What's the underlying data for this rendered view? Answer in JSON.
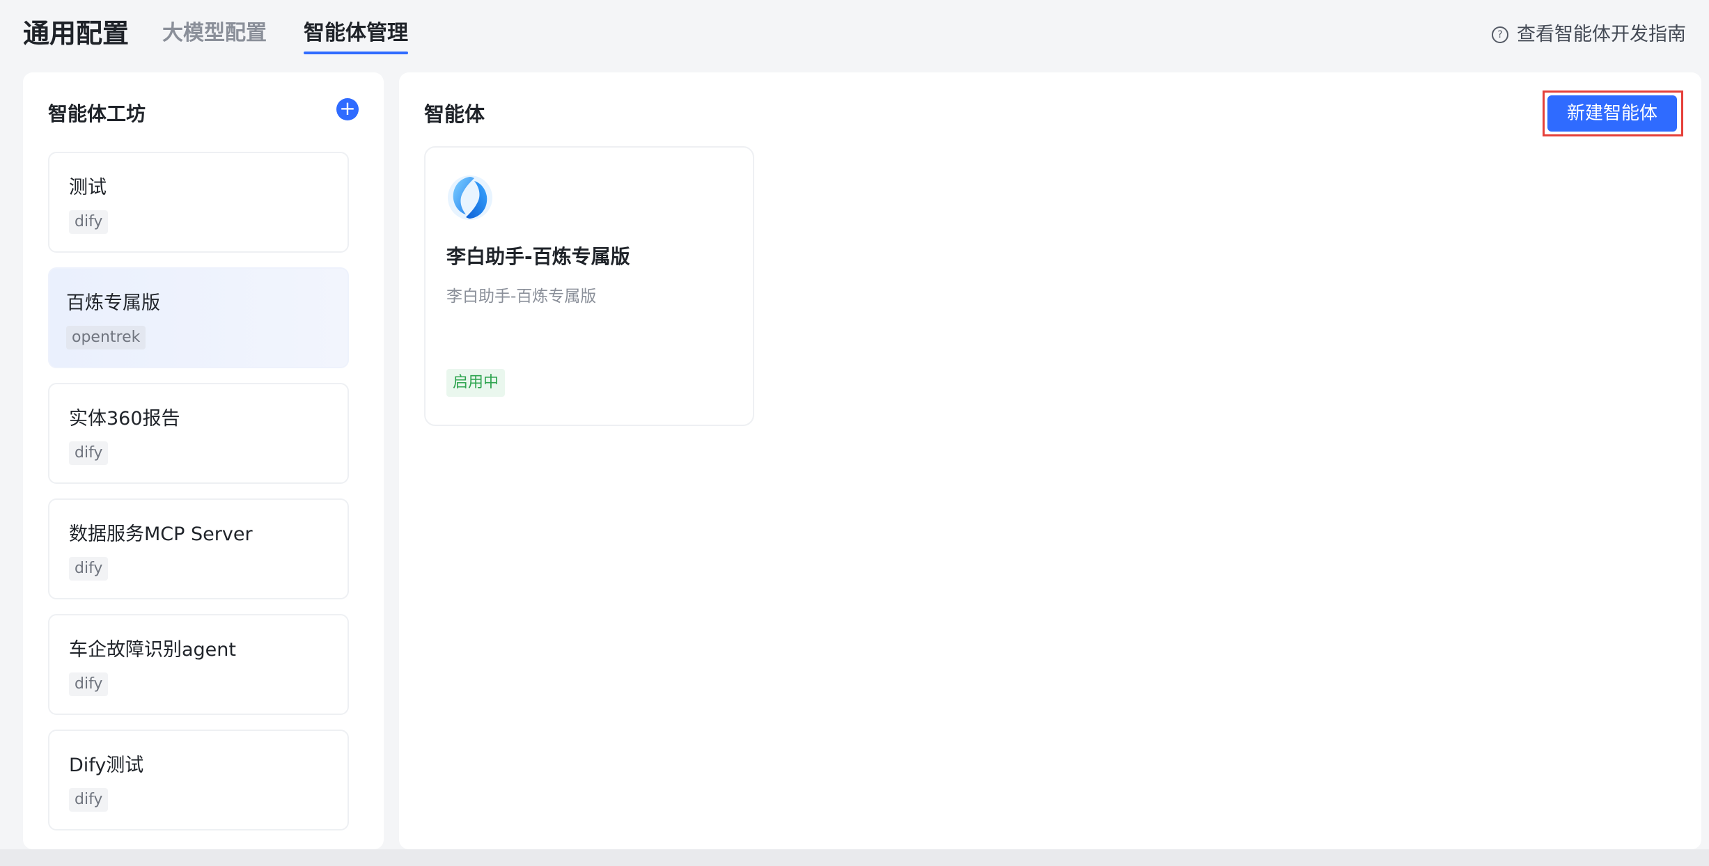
{
  "header": {
    "title": "通用配置",
    "tabs": [
      {
        "label": "大模型配置",
        "active": false
      },
      {
        "label": "智能体管理",
        "active": true
      }
    ],
    "guide_link": "查看智能体开发指南",
    "guide_icon": "help-circle-icon",
    "accent_color": "#2f6bff"
  },
  "sidebar": {
    "title": "智能体工坊",
    "add_icon": "plus-icon",
    "items": [
      {
        "name": "测试",
        "tag": "dify",
        "selected": false
      },
      {
        "name": "百炼专属版",
        "tag": "opentrek",
        "selected": true
      },
      {
        "name": "实体360报告",
        "tag": "dify",
        "selected": false
      },
      {
        "name": "数据服务MCP Server",
        "tag": "dify",
        "selected": false
      },
      {
        "name": "车企故障识别agent",
        "tag": "dify",
        "selected": false
      },
      {
        "name": "Dify测试",
        "tag": "dify",
        "selected": false
      }
    ]
  },
  "main": {
    "title": "智能体",
    "new_button": "新建智能体",
    "cards": [
      {
        "icon": "agent-logo-icon",
        "name": "李白助手-百炼专属版",
        "description": "李白助手-百炼专属版",
        "status": "启用中",
        "status_color": "#2ea44f"
      }
    ]
  }
}
